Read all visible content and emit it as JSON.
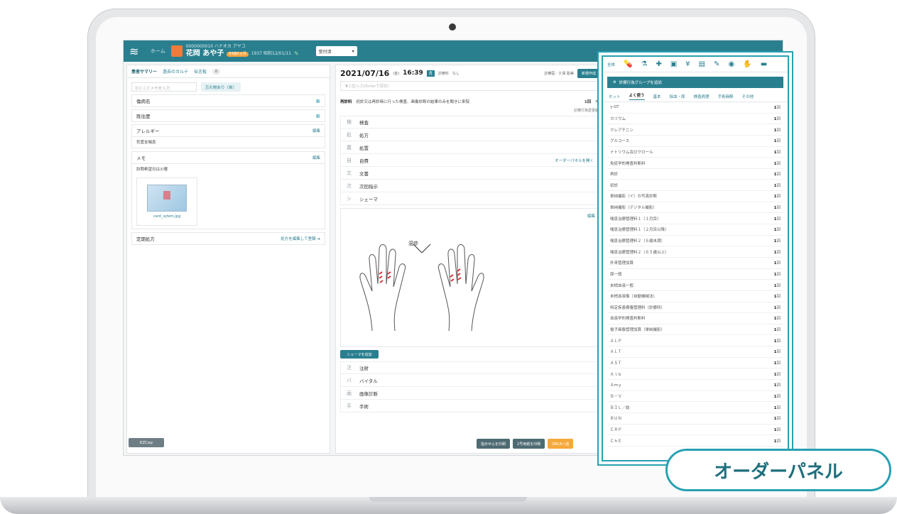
{
  "topbar": {
    "home_label": "ホーム",
    "patient_id": "0000000010 ハナオカ アヤコ",
    "patient_name": "花岡 あや子",
    "age_badge": "84歳5ヵ月",
    "dob": "1937 昭和12/01/11",
    "status_value": "受付済"
  },
  "left": {
    "tabs": [
      {
        "label": "患者サマリー"
      },
      {
        "label": "過去のカルテ"
      },
      {
        "label": "伝言板",
        "count": "0"
      }
    ],
    "memo_placeholder": "ひとことメモを入力",
    "forget_chip": "忘れ物あり（傘）",
    "disease_label": "傷病名",
    "history_label": "既往歴",
    "allergy_label": "アレルギー",
    "allergy_edit": "編集",
    "allergy_body": "気管支喘息",
    "memo_label": "メモ",
    "memo_edit": "編集",
    "memo_body": "訪問希望日は火曜",
    "card_filename": "card_sytem.jpg",
    "regular_rx_label": "定期処方",
    "regular_rx_link": "処方を編集して登録 ➔",
    "ezcap_label": "EZCap"
  },
  "mid": {
    "date": "2021/07/16",
    "weekday": "(金)",
    "time": "16:39",
    "tag": "再",
    "dept_label": "診療科",
    "dept_value": "なし",
    "doctor": "診察医：久保 聡美",
    "new_button": "新規作成",
    "search_placeholder": "▼上記入力(Enterで保存)",
    "revisit_title": "再診料",
    "revisit_desc": "初診又は再診時に行った検査、画像診断の結果のみを聞きに来院",
    "revisit_count": "1回",
    "revisit_mult": "x1",
    "history_link": "診療行為変更履",
    "rows": [
      {
        "icon": "検",
        "label": "検査"
      },
      {
        "icon": "処",
        "label": "処方"
      },
      {
        "icon": "置",
        "label": "処置"
      },
      {
        "icon": "自",
        "label": "自費",
        "link": "オーダーパネルを開く"
      },
      {
        "icon": "文",
        "label": "文書"
      },
      {
        "icon": "次",
        "label": "次回指示"
      },
      {
        "icon": "シ",
        "label": "シェーマ"
      }
    ],
    "schema_edit": "編集",
    "schema_label": "湿疹",
    "add_schema": "シェーマを追加",
    "rows2": [
      {
        "icon": "注",
        "label": "注射"
      },
      {
        "icon": "バ",
        "label": "バイタル"
      },
      {
        "icon": "画",
        "label": "画像診断"
      },
      {
        "icon": "手",
        "label": "手術"
      }
    ],
    "print_order": "指示せんを印刷",
    "print_no2": "2号用紙を印刷",
    "orca_button": "ORCAへ送"
  },
  "order_panel": {
    "all_label": "全体",
    "icons": [
      "pill-icon",
      "flask-icon",
      "bandage-icon",
      "package-icon",
      "money-icon",
      "doc-icon",
      "syringe-icon",
      "camera-icon",
      "hand-icon",
      "bed-icon"
    ],
    "add_group": "診療行為グループを追加",
    "tabs": [
      "セット",
      "よく使う",
      "基本",
      "採血・尿",
      "検査病理",
      "手術麻酔",
      "その他"
    ],
    "items": [
      {
        "name": "γ-GT",
        "count": "1"
      },
      {
        "name": "カリウム",
        "count": "1"
      },
      {
        "name": "クレアチニン",
        "count": "1"
      },
      {
        "name": "グルコース",
        "count": "1"
      },
      {
        "name": "ナトリウム及びクロール",
        "count": "1"
      },
      {
        "name": "免疫学的検査判断料",
        "count": "1"
      },
      {
        "name": "再診",
        "count": "1"
      },
      {
        "name": "初診",
        "count": "1"
      },
      {
        "name": "単純撮影（イ）の写真診断",
        "count": "1"
      },
      {
        "name": "単純撮影（デジタル撮影）",
        "count": "1"
      },
      {
        "name": "喘息治療管理料１（１月目）",
        "count": "1"
      },
      {
        "name": "喘息治療管理料１（２月目以降）",
        "count": "1"
      },
      {
        "name": "喘息治療管理料２（６歳未満）",
        "count": "1"
      },
      {
        "name": "喘息治療管理料２（６５歳以上）",
        "count": "1"
      },
      {
        "name": "外来管理加算",
        "count": "1"
      },
      {
        "name": "尿一般",
        "count": "1"
      },
      {
        "name": "末梢血液一般",
        "count": "1"
      },
      {
        "name": "末梢血液像（自動機械法）",
        "count": "1"
      },
      {
        "name": "特定疾患療養管理料（診療所）",
        "count": "1"
      },
      {
        "name": "血液学的検査判断料",
        "count": "1"
      },
      {
        "name": "電子画像管理加算（単純撮影）",
        "count": "1"
      },
      {
        "name": "ＡＬＰ",
        "count": "1"
      },
      {
        "name": "ＡＬＴ",
        "count": "1"
      },
      {
        "name": "ＡＳＴ",
        "count": "1"
      },
      {
        "name": "Ａｌｂ",
        "count": "1"
      },
      {
        "name": "Ａｍｙ",
        "count": "1"
      },
      {
        "name": "Ｂ－Ｖ",
        "count": "1"
      },
      {
        "name": "ＢＩＬ／総",
        "count": "1"
      },
      {
        "name": "ＢＵＮ",
        "count": "1"
      },
      {
        "name": "ＣＲＰ",
        "count": "1"
      },
      {
        "name": "ＣｈＥ",
        "count": "1"
      }
    ],
    "unit": "回"
  },
  "callout": "オーダーパネル"
}
